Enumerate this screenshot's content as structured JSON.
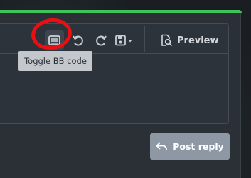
{
  "toolbar": {
    "bbcode_icon": "bbcode-toggle-icon",
    "undo_icon": "undo-icon",
    "redo_icon": "redo-icon",
    "drafts_icon": "save-drafts-icon",
    "preview_label": "Preview",
    "preview_icon": "document-search-icon"
  },
  "tooltip": {
    "text": "Toggle BB code"
  },
  "form": {
    "post_reply_label": "Post reply",
    "post_reply_icon": "reply-arrow-icon"
  },
  "colors": {
    "accent_bar": "#3fc35a",
    "highlight_ring": "#ec0f12",
    "button_bg": "#8e98a4",
    "tooltip_bg": "#c4c8cd"
  }
}
